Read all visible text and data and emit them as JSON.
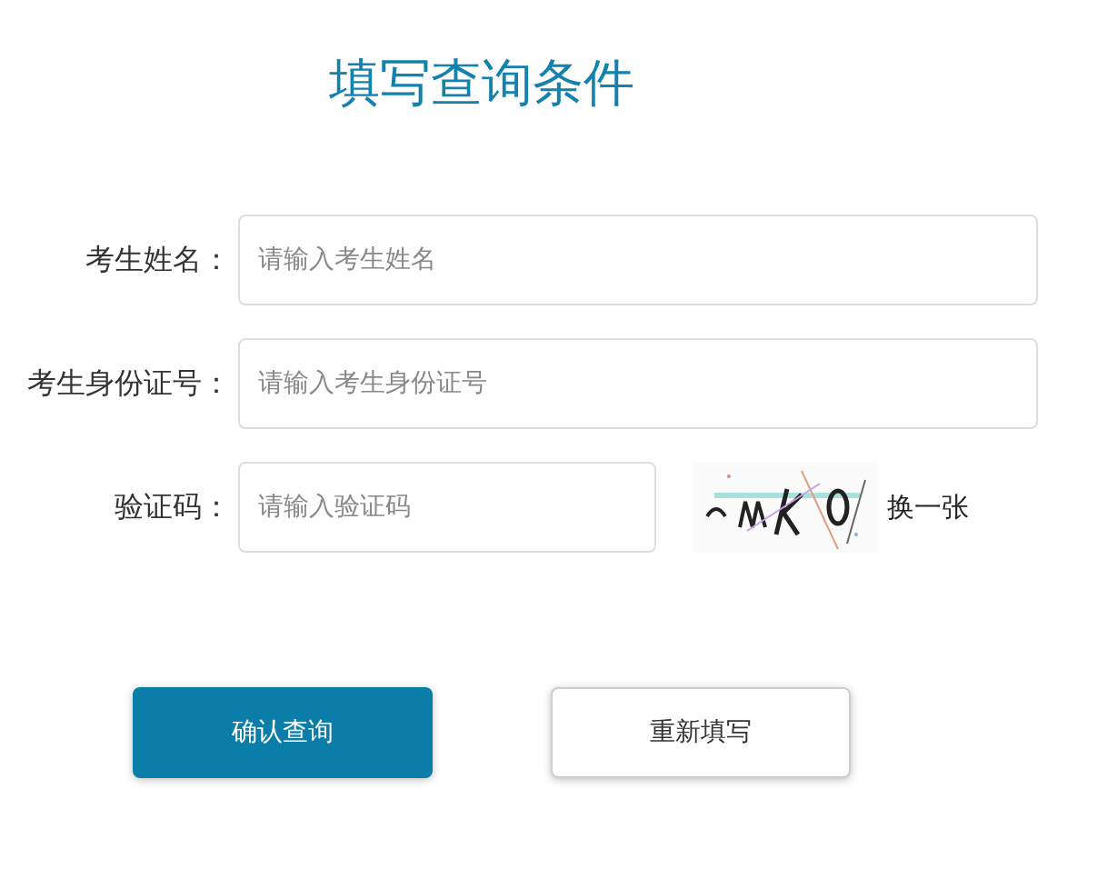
{
  "title": "填写查询条件",
  "fields": [
    {
      "label": "考生姓名：",
      "placeholder": "请输入考生姓名",
      "kind": "text"
    },
    {
      "label": "考生身份证号：",
      "placeholder": "请输入考生身份证号",
      "kind": "text"
    },
    {
      "label": "验证码：",
      "placeholder": "请输入验证码",
      "kind": "captcha",
      "refresh": "换一张"
    }
  ],
  "buttons": [
    {
      "label": "确认查询",
      "kind": "primary"
    },
    {
      "label": "重新填写",
      "kind": "secondary"
    }
  ]
}
